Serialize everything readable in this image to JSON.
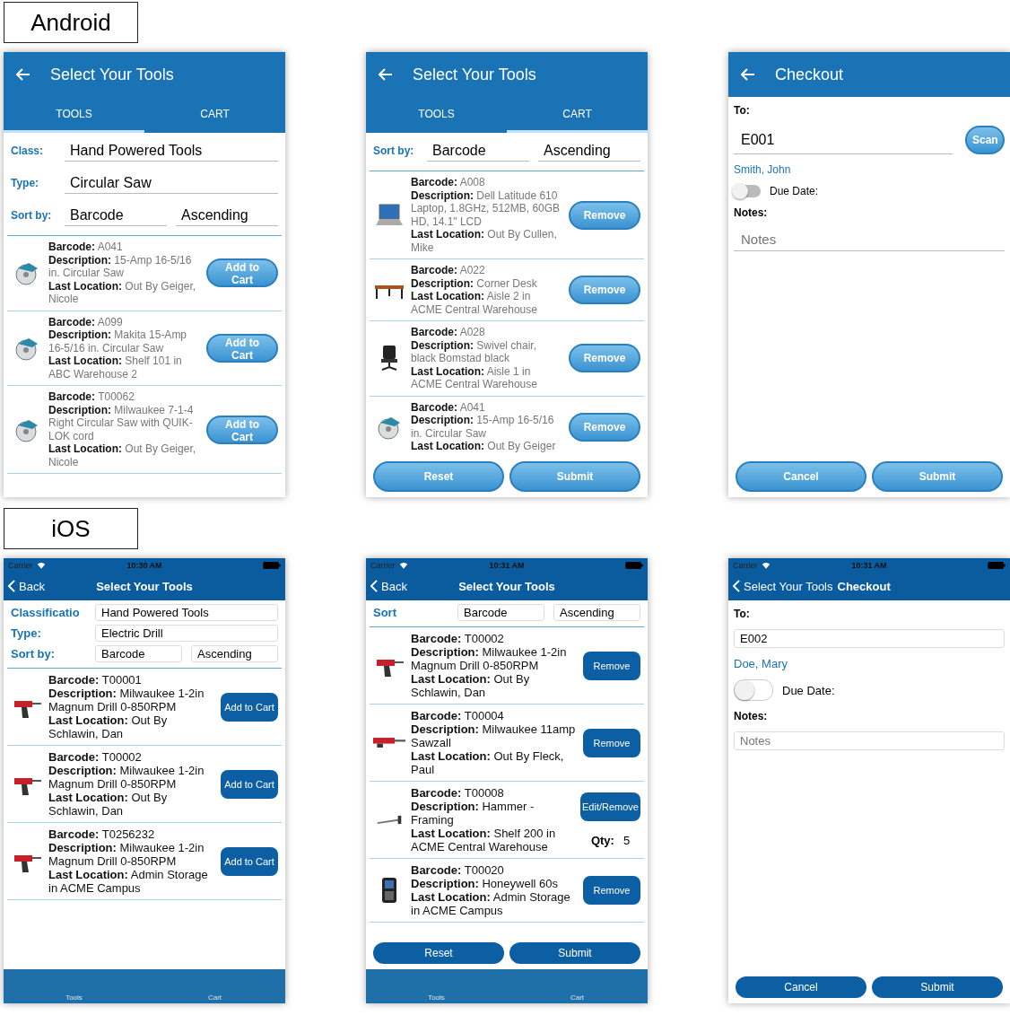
{
  "sections": [
    {
      "label": "Android",
      "kind": "android",
      "screens": [
        {
          "kind": "list",
          "title": "Select Your Tools",
          "tabs": [
            {
              "label": "TOOLS",
              "selected": true
            },
            {
              "label": "CART",
              "selected": false
            }
          ],
          "filters": [
            {
              "label": "Class:",
              "values": [
                "Hand Powered Tools"
              ]
            },
            {
              "label": "Type:",
              "values": [
                "Circular Saw"
              ]
            },
            {
              "label": "Sort by:",
              "values": [
                "Barcode",
                "Ascending"
              ]
            }
          ],
          "items": [
            {
              "kind": "saw",
              "lines": [
                "**Barcode:** A041",
                "**Description:** 15-Amp 16-5/16 in. Circular Saw",
                "**Last Location:** Out By Geiger, Nicole"
              ],
              "button": "Add to Cart"
            },
            {
              "kind": "saw",
              "lines": [
                "**Barcode:** A099",
                "**Description:** Makita 15-Amp 16-5/16 in. Circular Saw",
                "**Last Location:** Shelf 101 in ABC Warehouse 2"
              ],
              "button": "Add to Cart"
            },
            {
              "kind": "saw",
              "lines": [
                "**Barcode:** T00062",
                "**Description:** Milwaukee 7-1-4 Right Circular Saw with QUIK-LOK cord",
                "**Last Location:** Out By Geiger, Nicole"
              ],
              "button": "Add to Cart"
            }
          ]
        },
        {
          "kind": "list",
          "title": "Select Your Tools",
          "tabs": [
            {
              "label": "TOOLS",
              "selected": false
            },
            {
              "label": "CART",
              "selected": true
            }
          ],
          "filters": [
            {
              "label": "Sort by:",
              "values": [
                "Barcode",
                "Ascending"
              ]
            }
          ],
          "items": [
            {
              "kind": "laptop",
              "lines": [
                "**Barcode:** A008",
                "**Description:** Dell Latitude 610 Laptop, 1.8GHz, 512MB, 60GB HD, 14.1\" LCD",
                "**Last Location:** Out By Cullen, Mike"
              ],
              "button": "Remove"
            },
            {
              "kind": "desk",
              "lines": [
                "**Barcode:** A022",
                "**Description:** Corner Desk",
                "**Last Location:** Aisle 2 in ACME Central Warehouse"
              ],
              "button": "Remove"
            },
            {
              "kind": "chair",
              "lines": [
                "**Barcode:** A028",
                "**Description:** Swivel chair, black Bomstad black",
                "**Last Location:** Aisle 1 in ACME Central Warehouse"
              ],
              "button": "Remove"
            },
            {
              "kind": "saw",
              "lines": [
                "**Barcode:** A041",
                "**Description:** 15-Amp 16-5/16 in. Circular Saw",
                "**Last Location:** Out By Geiger"
              ],
              "button": "Remove"
            }
          ],
          "footer_buttons": [
            "Reset",
            "Submit"
          ]
        },
        {
          "kind": "checkout",
          "title": "Checkout",
          "to_label": "To:",
          "to_value": "E001",
          "scan": "Scan",
          "person": "Smith, John",
          "toggle": {
            "label": "Due Date:",
            "on": false
          },
          "notes_label": "Notes:",
          "notes_placeholder": "Notes",
          "footer_buttons": [
            "Cancel",
            "Submit"
          ]
        }
      ]
    },
    {
      "label": "iOS",
      "kind": "ios",
      "screens": [
        {
          "kind": "list",
          "status": {
            "carrier": "Carrier",
            "time": "10:30 AM"
          },
          "back": "Back",
          "title": "Select Your Tools",
          "filters": [
            {
              "label": "Classificatio",
              "values": [
                "Hand Powered Tools"
              ]
            },
            {
              "label": "Type:",
              "values": [
                "Electric Drill"
              ]
            },
            {
              "label": "Sort by:",
              "values": [
                "Barcode",
                "Ascending"
              ]
            }
          ],
          "items": [
            {
              "kind": "drill",
              "lines": [
                "**Barcode:** T00001",
                "**Description:** Milwaukee 1-2in Magnum Drill 0-850RPM",
                "**Last Location:** Out By Schlawin, Dan"
              ],
              "button": "Add to Cart"
            },
            {
              "kind": "drill",
              "lines": [
                "**Barcode:** T00002",
                "**Description:** Milwaukee 1-2in Magnum Drill 0-850RPM",
                "**Last Location:** Out By Schlawin, Dan"
              ],
              "button": "Add to Cart"
            },
            {
              "kind": "drill",
              "lines": [
                "**Barcode:** T0256232",
                "**Description:** Milwaukee 1-2in Magnum Drill 0-850RPM",
                "**Last Location:** Admin Storage in ACME Campus"
              ],
              "button": "Add to Cart"
            }
          ],
          "bottom_tabs": [
            "Tools",
            "Cart"
          ]
        },
        {
          "kind": "list",
          "status": {
            "carrier": "Carrier",
            "time": "10:31 AM"
          },
          "back": "Back",
          "title": "Select Your Tools",
          "filters": [
            {
              "label": "Sort",
              "values": [
                "Barcode",
                "Ascending"
              ]
            }
          ],
          "items": [
            {
              "kind": "drill",
              "lines": [
                "**Barcode:** T00002",
                "**Description:** Milwaukee 1-2in Magnum Drill 0-850RPM",
                "**Last Location:** Out By Schlawin, Dan"
              ],
              "button": "Remove"
            },
            {
              "kind": "saw-blade",
              "lines": [
                "**Barcode:** T00004",
                "**Description:** Milwaukee 11amp Sawzall",
                "**Last Location:** Out By Fleck, Paul"
              ],
              "button": "Remove"
            },
            {
              "kind": "hammer",
              "lines": [
                "**Barcode:** T00008",
                "**Description:** Hammer - Framing",
                "**Last Location:** Shelf 200 in ACME Central Warehouse"
              ],
              "button": "Edit/Remove",
              "qty_label": "Qty:",
              "qty": "5"
            },
            {
              "kind": "handheld",
              "lines": [
                "**Barcode:** T00020",
                "**Description:** Honeywell 60s",
                "**Last Location:** Admin Storage in ACME Campus"
              ],
              "button": "Remove"
            }
          ],
          "footer_buttons": [
            "Reset",
            "Submit"
          ],
          "bottom_tabs": [
            "Tools",
            "Cart"
          ]
        },
        {
          "kind": "checkout",
          "status": {
            "carrier": "Carrier",
            "time": "10:31 AM"
          },
          "back": "Select Your Tools",
          "title": "Checkout",
          "to_label": "To:",
          "to_value": "E002",
          "person": "Doe, Mary",
          "toggle": {
            "label": "Due Date:",
            "on": false
          },
          "notes_label": "Notes:",
          "notes_placeholder": "Notes",
          "footer_buttons": [
            "Cancel",
            "Submit"
          ]
        }
      ]
    }
  ]
}
